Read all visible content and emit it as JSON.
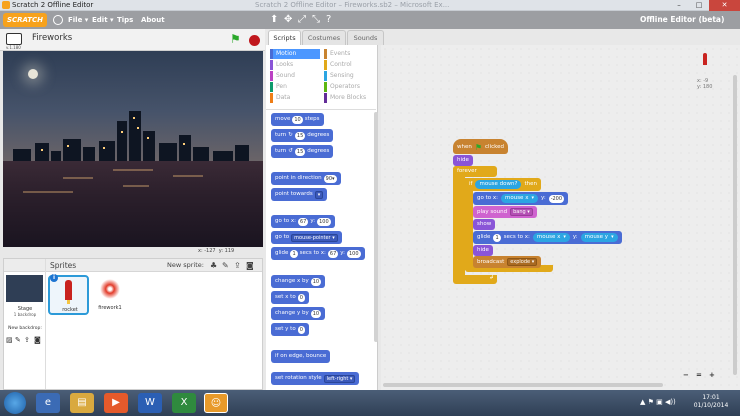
{
  "window": {
    "title": "Scratch 2 Offline Editor",
    "title_faded": "Scratch 2 Offline Editor – Fireworks.sb2 – Microsoft Ex...",
    "buttons": [
      "–",
      "□",
      "✕"
    ]
  },
  "menubar": {
    "logo": "SCRATCH",
    "items": [
      "File ▾",
      "Edit ▾",
      "Tips",
      "About"
    ],
    "right_label": "Offline Editor (beta)",
    "tools": [
      "duplicate-icon",
      "cut-icon",
      "grow-icon",
      "shrink-icon",
      "help-icon"
    ]
  },
  "stage": {
    "project_name": "Fireworks",
    "version": "v.1.180",
    "mouse_x": "x: -127",
    "mouse_y": "y: 119"
  },
  "sprites_panel": {
    "title": "Sprites",
    "new_sprite_label": "New sprite:",
    "stage_label": "Stage",
    "stage_sub": "1 backdrop",
    "new_backdrop_label": "New backdrop:",
    "sprites": [
      {
        "name": "rocket",
        "selected": true
      },
      {
        "name": "firework1",
        "selected": false
      }
    ]
  },
  "tabs": [
    "Scripts",
    "Costumes",
    "Sounds"
  ],
  "categories": [
    {
      "name": "Motion",
      "color": "#4a6cd4",
      "selected": true
    },
    {
      "name": "Events",
      "color": "#c88330"
    },
    {
      "name": "Looks",
      "color": "#8a55d7"
    },
    {
      "name": "Control",
      "color": "#e1a91a"
    },
    {
      "name": "Sound",
      "color": "#bb42c3"
    },
    {
      "name": "Sensing",
      "color": "#2ca5e2"
    },
    {
      "name": "Pen",
      "color": "#0e9a6c"
    },
    {
      "name": "Operators",
      "color": "#5cb712"
    },
    {
      "name": "Data",
      "color": "#ee7d16"
    },
    {
      "name": "More Blocks",
      "color": "#632d99"
    }
  ],
  "palette_blocks": {
    "move": {
      "a": "move",
      "b": "10",
      "c": "steps"
    },
    "turn_cw": {
      "a": "turn",
      "b": "15",
      "c": "degrees"
    },
    "turn_ccw": {
      "a": "turn",
      "b": "15",
      "c": "degrees"
    },
    "point_dir": {
      "a": "point in direction",
      "b": "90▾"
    },
    "point_towards": {
      "a": "point towards",
      "b": "▾"
    },
    "goto_xy": {
      "a": "go to x:",
      "b": "67",
      "c": "y:",
      "d": "100"
    },
    "goto": {
      "a": "go to",
      "b": "mouse-pointer ▾"
    },
    "glide": {
      "a": "glide",
      "b": "1",
      "c": "secs to x:",
      "d": "67",
      "e": "y:",
      "f": "100"
    },
    "change_x": {
      "a": "change x by",
      "b": "10"
    },
    "set_x": {
      "a": "set x to",
      "b": "0"
    },
    "change_y": {
      "a": "change y by",
      "b": "10"
    },
    "set_y": {
      "a": "set y to",
      "b": "0"
    },
    "bounce": {
      "a": "if on edge, bounce"
    },
    "rotation": {
      "a": "set rotation style",
      "b": "left-right ▾"
    }
  },
  "script": {
    "hat": "when",
    "hat_tail": "clicked",
    "hide": "hide",
    "forever": "forever",
    "if": "if",
    "mouse_down": "mouse down?",
    "then": "then",
    "goto_x": "go to x:",
    "mouse_x": "mouse x",
    "y": "y:",
    "y_val": "-200",
    "play_sound": "play sound",
    "sound": "bang ▾",
    "show": "show",
    "glide": "glide",
    "glide_secs": "1",
    "secs_to_x": "secs to x:",
    "mouse_x2": "mouse x",
    "y2": "y:",
    "mouse_y": "mouse y",
    "hide2": "hide",
    "broadcast": "broadcast",
    "message": "explode ▾"
  },
  "scripts_area": {
    "x_readout": "x: -9",
    "y_readout": "y: 180",
    "zoom_buttons": [
      "−",
      "=",
      "+"
    ]
  },
  "taskbar": {
    "time": "17:01",
    "date": "01/10/2014"
  }
}
